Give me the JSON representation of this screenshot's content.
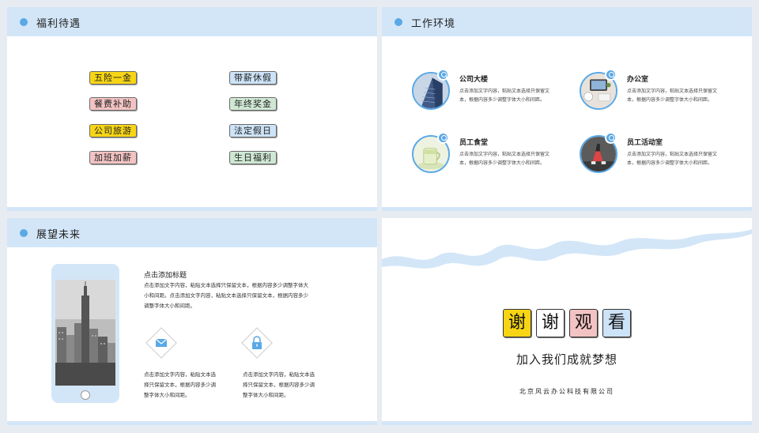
{
  "colors": {
    "accent": "#5aa9e6",
    "header_bg": "#d3e6f8",
    "yellow": "#f7d515",
    "pink": "#f3c3c3",
    "light_blue": "#cde3f7",
    "green": "#cfe8d4"
  },
  "benefits": {
    "title": "福利待遇",
    "tags": [
      "五险一金",
      "带薪休假",
      "餐费补助",
      "年终奖金",
      "公司旅游",
      "法定假日",
      "加班加薪",
      "生日福利"
    ]
  },
  "environment": {
    "title": "工作环境",
    "items": [
      {
        "title": "公司大楼",
        "desc": "点击添加文字内容，粘贴文本选择只保留文本，根据内容多少调整字体大小和间距。"
      },
      {
        "title": "办公室",
        "desc": "点击添加文字内容，粘贴文本选择只保留文本，根据内容多少调整字体大小和间距。"
      },
      {
        "title": "员工食堂",
        "desc": "点击添加文字内容，粘贴文本选择只保留文本，根据内容多少调整字体大小和间距。"
      },
      {
        "title": "员工活动室",
        "desc": "点击添加文字内容，粘贴文本选择只保留文本，根据内容多少调整字体大小和间距。"
      }
    ]
  },
  "future": {
    "title": "展望未来",
    "heading": "点击添加标题",
    "paragraph": "点击添加文字内容，粘贴文本选择只保留文本，根据内容多少调整字体大小和间距。点击添加文字内容，粘贴文本选择只保留文本，根据内容多少调整字体大小和间距。",
    "col1": "点击添加文字内容，粘贴文本选择只保留文本，根据内容多少调整字体大小和间距。",
    "col2": "点击添加文字内容，粘贴文本选择只保留文本，根据内容多少调整字体大小和间距。",
    "icons": [
      "mail-icon",
      "lock-icon"
    ]
  },
  "closing": {
    "thanks": [
      "谢",
      "谢",
      "观",
      "看"
    ],
    "subtitle": "加入我们成就梦想",
    "company": "北京风云办公科技有限公司"
  }
}
